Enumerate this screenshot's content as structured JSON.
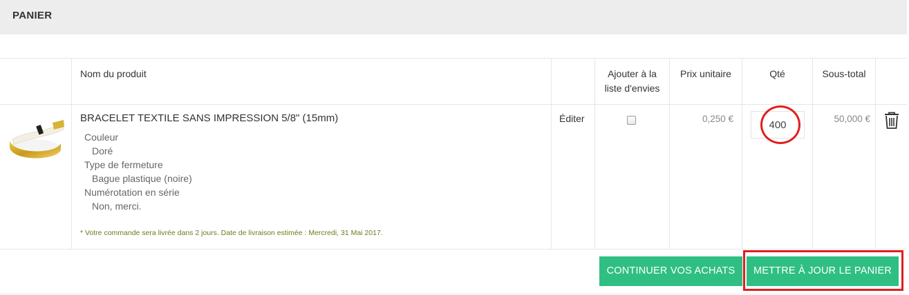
{
  "cart": {
    "title": "PANIER"
  },
  "table": {
    "headers": {
      "product_name": "Nom du produit",
      "wishlist_line1": "Ajouter à la",
      "wishlist_line2": "liste d'envies",
      "unit_price": "Prix unitaire",
      "qty": "Qté",
      "subtotal": "Sous-total"
    },
    "items": [
      {
        "name": "BRACELET TEXTILE SANS IMPRESSION 5/8\" (15mm)",
        "options": [
          {
            "label": "Couleur",
            "value": "Doré"
          },
          {
            "label": "Type de fermeture",
            "value": "Bague plastique (noire)"
          },
          {
            "label": "Numérotation en série",
            "value": "Non, merci."
          }
        ],
        "delivery_note": "* Votre commande sera livrée dans 2 jours. Date de livraison estimée : Mercredi, 31 Mai 2017.",
        "edit_label": "Éditer",
        "wishlist_checked": false,
        "unit_price": "0,250 €",
        "quantity": "400",
        "subtotal": "50,000 €",
        "image_icon": "gold-textile-bracelet-image"
      }
    ]
  },
  "actions": {
    "continue_label": "CONTINUER VOS ACHATS",
    "update_label": "METTRE À JOUR LE PANIER"
  },
  "colors": {
    "header_bg": "#ededed",
    "button_green": "#2fbf83",
    "highlight_red": "#e01e1e",
    "delivery_note": "#6b7b1e"
  },
  "icons": {
    "delete": "trash-icon"
  }
}
